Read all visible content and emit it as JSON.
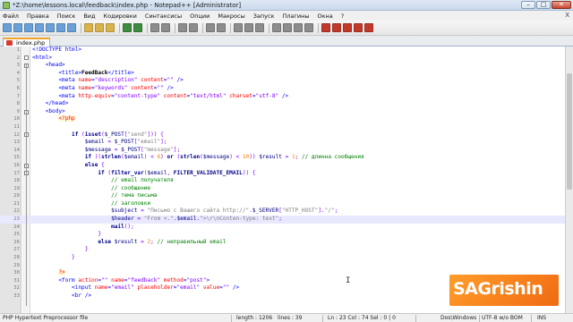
{
  "window": {
    "title": "*Z:\\home\\lessons.local\\feedback\\index.php - Notepad++ [Administrator]",
    "controls": [
      "–",
      "□",
      "✕"
    ]
  },
  "menubar": {
    "items": [
      "Файл",
      "Правка",
      "Поиск",
      "Вид",
      "Кодировки",
      "Синтаксисы",
      "Опции",
      "Макросы",
      "Запуск",
      "Плагины",
      "Окна",
      "?"
    ],
    "close_glyph": "X"
  },
  "toolbar": {
    "buttons": [
      "new",
      "open",
      "save",
      "save-all",
      "close",
      "close-all",
      "print",
      "sep",
      "cut",
      "copy",
      "paste",
      "sep",
      "undo",
      "redo",
      "sep",
      "find",
      "replace",
      "sep",
      "zoom-in",
      "zoom-out",
      "sep",
      "sync-v",
      "sync-h",
      "sep",
      "wrap",
      "all-chars",
      "indent-guide",
      "sep",
      "lang",
      "doc-map",
      "func-list",
      "folder",
      "sep",
      "record",
      "stop",
      "play",
      "play-multi",
      "save-macro"
    ],
    "colors": {
      "file": "#6aa0d8",
      "edit": "#d9b34a",
      "undo": "#3f8b3f",
      "find": "#8d8d8d",
      "macro": "#c0392b"
    }
  },
  "tabs": [
    {
      "label": "index.php",
      "active": true
    }
  ],
  "editor": {
    "current_line": 23,
    "lines": [
      {
        "n": "1",
        "segs": [
          [
            "t-tag",
            "<!DOCTYPE html>"
          ]
        ]
      },
      {
        "n": "2",
        "segs": [
          [
            "t-tag",
            "<html>"
          ]
        ]
      },
      {
        "n": "3",
        "segs": [
          [
            "t-plain",
            "    "
          ],
          [
            "t-tag",
            "<head>"
          ]
        ]
      },
      {
        "n": "4",
        "segs": [
          [
            "t-plain",
            "        "
          ],
          [
            "t-tag",
            "<title>"
          ],
          [
            "t-text",
            "FeedBack"
          ],
          [
            "t-tag",
            "</title>"
          ]
        ]
      },
      {
        "n": "5",
        "segs": [
          [
            "t-plain",
            "        "
          ],
          [
            "t-tag",
            "<meta "
          ],
          [
            "t-attr",
            "name"
          ],
          [
            "t-tag",
            "="
          ],
          [
            "t-str",
            "\"description\""
          ],
          [
            "t-tag",
            " "
          ],
          [
            "t-attr",
            "content"
          ],
          [
            "t-tag",
            "="
          ],
          [
            "t-str",
            "\"\""
          ],
          [
            "t-tag",
            " />"
          ]
        ]
      },
      {
        "n": "6",
        "segs": [
          [
            "t-plain",
            "        "
          ],
          [
            "t-tag",
            "<meta "
          ],
          [
            "t-attr",
            "name"
          ],
          [
            "t-tag",
            "="
          ],
          [
            "t-str",
            "\"keywords\""
          ],
          [
            "t-tag",
            " "
          ],
          [
            "t-attr",
            "content"
          ],
          [
            "t-tag",
            "="
          ],
          [
            "t-str",
            "\"\""
          ],
          [
            "t-tag",
            " />"
          ]
        ]
      },
      {
        "n": "7",
        "segs": [
          [
            "t-plain",
            "        "
          ],
          [
            "t-tag",
            "<meta "
          ],
          [
            "t-attr",
            "http-equiv"
          ],
          [
            "t-tag",
            "="
          ],
          [
            "t-str",
            "\"content-type\""
          ],
          [
            "t-tag",
            " "
          ],
          [
            "t-attr",
            "content"
          ],
          [
            "t-tag",
            "="
          ],
          [
            "t-str",
            "\"text/html\""
          ],
          [
            "t-tag",
            " "
          ],
          [
            "t-attr",
            "charset"
          ],
          [
            "t-tag",
            "="
          ],
          [
            "t-str",
            "\"utf-8\""
          ],
          [
            "t-tag",
            " />"
          ]
        ]
      },
      {
        "n": "8",
        "segs": [
          [
            "t-plain",
            "    "
          ],
          [
            "t-tag",
            "</head>"
          ]
        ]
      },
      {
        "n": "9",
        "segs": [
          [
            "t-plain",
            "    "
          ],
          [
            "t-tag",
            "<body>"
          ]
        ]
      },
      {
        "n": "10",
        "segs": [
          [
            "t-plain",
            "        "
          ],
          [
            "t-php",
            "<?php"
          ]
        ]
      },
      {
        "n": "11",
        "segs": [
          [
            "t-plain",
            ""
          ]
        ]
      },
      {
        "n": "12",
        "segs": [
          [
            "t-plain",
            "            "
          ],
          [
            "t-kw",
            "if"
          ],
          [
            "t-plain",
            " "
          ],
          [
            "t-op",
            "("
          ],
          [
            "t-kw",
            "isset"
          ],
          [
            "t-op",
            "("
          ],
          [
            "t-var",
            "$_POST"
          ],
          [
            "t-op",
            "["
          ],
          [
            "t-phpstr",
            "\"send\""
          ],
          [
            "t-op",
            "])) {"
          ]
        ]
      },
      {
        "n": "13",
        "segs": [
          [
            "t-plain",
            "                "
          ],
          [
            "t-var",
            "$email"
          ],
          [
            "t-op",
            " = "
          ],
          [
            "t-var",
            "$_POST"
          ],
          [
            "t-op",
            "["
          ],
          [
            "t-phpstr",
            "\"email\""
          ],
          [
            "t-op",
            "];"
          ]
        ]
      },
      {
        "n": "14",
        "segs": [
          [
            "t-plain",
            "                "
          ],
          [
            "t-var",
            "$message"
          ],
          [
            "t-op",
            " = "
          ],
          [
            "t-var",
            "$_POST"
          ],
          [
            "t-op",
            "["
          ],
          [
            "t-phpstr",
            "\"message\""
          ],
          [
            "t-op",
            "];"
          ]
        ]
      },
      {
        "n": "15",
        "segs": [
          [
            "t-plain",
            "                "
          ],
          [
            "t-kw",
            "if"
          ],
          [
            "t-op",
            " (("
          ],
          [
            "t-kw",
            "strlen"
          ],
          [
            "t-op",
            "("
          ],
          [
            "t-var",
            "$email"
          ],
          [
            "t-op",
            ") < "
          ],
          [
            "t-num",
            "6"
          ],
          [
            "t-op",
            ") "
          ],
          [
            "t-kw",
            "or"
          ],
          [
            "t-op",
            " ("
          ],
          [
            "t-kw",
            "strlen"
          ],
          [
            "t-op",
            "("
          ],
          [
            "t-var",
            "$message"
          ],
          [
            "t-op",
            ") < "
          ],
          [
            "t-num",
            "10"
          ],
          [
            "t-op",
            ")) "
          ],
          [
            "t-var",
            "$result"
          ],
          [
            "t-op",
            " = "
          ],
          [
            "t-num",
            "1"
          ],
          [
            "t-op",
            "; "
          ],
          [
            "t-cm",
            "// длинна сообщения"
          ]
        ]
      },
      {
        "n": "16",
        "segs": [
          [
            "t-plain",
            "                "
          ],
          [
            "t-kw",
            "else"
          ],
          [
            "t-op",
            " {"
          ]
        ]
      },
      {
        "n": "17",
        "segs": [
          [
            "t-plain",
            "                    "
          ],
          [
            "t-kw",
            "if"
          ],
          [
            "t-op",
            " ("
          ],
          [
            "t-kw",
            "filter_var"
          ],
          [
            "t-op",
            "("
          ],
          [
            "t-var",
            "$email"
          ],
          [
            "t-op",
            ", "
          ],
          [
            "t-kw",
            "FILTER_VALIDATE_EMAIL"
          ],
          [
            "t-op",
            ")) {"
          ]
        ]
      },
      {
        "n": "18",
        "segs": [
          [
            "t-plain",
            "                        "
          ],
          [
            "t-cm",
            "// email получателя"
          ]
        ]
      },
      {
        "n": "19",
        "segs": [
          [
            "t-plain",
            "                        "
          ],
          [
            "t-cm",
            "// сообщение"
          ]
        ]
      },
      {
        "n": "20",
        "segs": [
          [
            "t-plain",
            "                        "
          ],
          [
            "t-cm",
            "// тема письма"
          ]
        ]
      },
      {
        "n": "21",
        "segs": [
          [
            "t-plain",
            "                        "
          ],
          [
            "t-cm",
            "// заголовки"
          ]
        ]
      },
      {
        "n": "22",
        "segs": [
          [
            "t-plain",
            "                        "
          ],
          [
            "t-var",
            "$subject"
          ],
          [
            "t-op",
            " = "
          ],
          [
            "t-phpstr",
            "\"Письмо с Вашего сайта http://\""
          ],
          [
            "t-op",
            "."
          ],
          [
            "t-var",
            "$_SERVER"
          ],
          [
            "t-op",
            "["
          ],
          [
            "t-phpstr",
            "\"HTTP_HOST\""
          ],
          [
            "t-op",
            "]."
          ],
          [
            "t-phpstr",
            "\"/\""
          ],
          [
            "t-op",
            ";"
          ]
        ]
      },
      {
        "n": "23",
        "segs": [
          [
            "t-plain",
            "                        "
          ],
          [
            "t-var",
            "$header"
          ],
          [
            "t-op",
            " = "
          ],
          [
            "t-phpstr",
            "\"From <.\""
          ],
          [
            "t-op",
            "."
          ],
          [
            "t-var",
            "$email"
          ],
          [
            "t-op",
            "."
          ],
          [
            "t-phpstr",
            "\">\\r\\nConten-type: text\""
          ],
          [
            "t-op",
            ";"
          ]
        ]
      },
      {
        "n": "24",
        "segs": [
          [
            "t-plain",
            "                        "
          ],
          [
            "t-kw",
            "mail"
          ],
          [
            "t-op",
            "();"
          ]
        ]
      },
      {
        "n": "25",
        "segs": [
          [
            "t-plain",
            "                    "
          ],
          [
            "t-op",
            "}"
          ]
        ]
      },
      {
        "n": "26",
        "segs": [
          [
            "t-plain",
            "                    "
          ],
          [
            "t-kw",
            "else"
          ],
          [
            "t-plain",
            " "
          ],
          [
            "t-var",
            "$result"
          ],
          [
            "t-op",
            " = "
          ],
          [
            "t-num",
            "2"
          ],
          [
            "t-op",
            "; "
          ],
          [
            "t-cm",
            "// неправильный email"
          ]
        ]
      },
      {
        "n": "27",
        "segs": [
          [
            "t-plain",
            "                "
          ],
          [
            "t-op",
            "}"
          ]
        ]
      },
      {
        "n": "28",
        "segs": [
          [
            "t-plain",
            "            "
          ],
          [
            "t-op",
            "}"
          ]
        ]
      },
      {
        "n": "29",
        "segs": [
          [
            "t-plain",
            ""
          ]
        ]
      },
      {
        "n": "30",
        "segs": [
          [
            "t-plain",
            "        "
          ],
          [
            "t-php",
            "?>"
          ]
        ]
      },
      {
        "n": "31",
        "segs": [
          [
            "t-plain",
            "        "
          ],
          [
            "t-tag",
            "<form "
          ],
          [
            "t-attr",
            "action"
          ],
          [
            "t-tag",
            "="
          ],
          [
            "t-str",
            "\"\""
          ],
          [
            "t-tag",
            " "
          ],
          [
            "t-attr",
            "name"
          ],
          [
            "t-tag",
            "="
          ],
          [
            "t-str",
            "\"feedback\""
          ],
          [
            "t-tag",
            " "
          ],
          [
            "t-attr",
            "method"
          ],
          [
            "t-tag",
            "="
          ],
          [
            "t-str",
            "\"post\""
          ],
          [
            "t-tag",
            ">"
          ]
        ]
      },
      {
        "n": "32",
        "segs": [
          [
            "t-plain",
            "            "
          ],
          [
            "t-tag",
            "<input "
          ],
          [
            "t-attr",
            "name"
          ],
          [
            "t-tag",
            "="
          ],
          [
            "t-str",
            "\"email\""
          ],
          [
            "t-tag",
            " "
          ],
          [
            "t-attr",
            "placeholder"
          ],
          [
            "t-tag",
            "="
          ],
          [
            "t-str",
            "\"email\""
          ],
          [
            "t-tag",
            " "
          ],
          [
            "t-attr",
            "value"
          ],
          [
            "t-tag",
            "="
          ],
          [
            "t-str",
            "\"\""
          ],
          [
            "t-tag",
            " />"
          ]
        ]
      },
      {
        "n": "33",
        "segs": [
          [
            "t-plain",
            "            "
          ],
          [
            "t-tag",
            "<br />"
          ]
        ]
      }
    ]
  },
  "statusbar": {
    "file_type": "PHP Hypertext Preprocessor file",
    "length": "length : 1206",
    "lines": "lines : 39",
    "position": "Ln : 23    Col : 74    Sel : 0 | 0",
    "eol": "Dos\\Windows",
    "encoding": "UTF-8 w/o BOM",
    "mode": "INS"
  },
  "watermark": {
    "text": "SAGrishin"
  }
}
